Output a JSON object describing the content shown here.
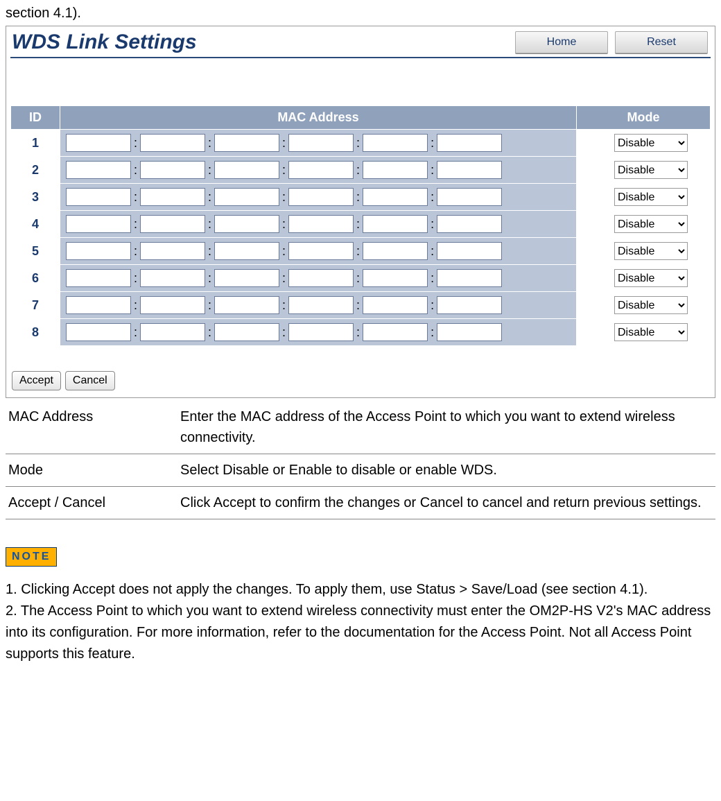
{
  "intro": "section 4.1).",
  "panel": {
    "title": "WDS Link Settings",
    "header_buttons": {
      "home": "Home",
      "reset": "Reset"
    },
    "table": {
      "headers": {
        "id": "ID",
        "mac": "MAC Address",
        "mode": "Mode"
      },
      "mac_sep": ":",
      "mode_options": [
        "Disable",
        "Enable"
      ],
      "rows": [
        {
          "id": "1",
          "mac": [
            "",
            "",
            "",
            "",
            "",
            ""
          ],
          "mode": "Disable"
        },
        {
          "id": "2",
          "mac": [
            "",
            "",
            "",
            "",
            "",
            ""
          ],
          "mode": "Disable"
        },
        {
          "id": "3",
          "mac": [
            "",
            "",
            "",
            "",
            "",
            ""
          ],
          "mode": "Disable"
        },
        {
          "id": "4",
          "mac": [
            "",
            "",
            "",
            "",
            "",
            ""
          ],
          "mode": "Disable"
        },
        {
          "id": "5",
          "mac": [
            "",
            "",
            "",
            "",
            "",
            ""
          ],
          "mode": "Disable"
        },
        {
          "id": "6",
          "mac": [
            "",
            "",
            "",
            "",
            "",
            ""
          ],
          "mode": "Disable"
        },
        {
          "id": "7",
          "mac": [
            "",
            "",
            "",
            "",
            "",
            ""
          ],
          "mode": "Disable"
        },
        {
          "id": "8",
          "mac": [
            "",
            "",
            "",
            "",
            "",
            ""
          ],
          "mode": "Disable"
        }
      ]
    },
    "footer_buttons": {
      "accept": "Accept",
      "cancel": "Cancel"
    }
  },
  "descriptions": [
    {
      "label": "MAC Address",
      "text": "Enter the MAC address of the Access Point to which you want to extend wireless connectivity."
    },
    {
      "label": "Mode",
      "text": "Select Disable or Enable to disable or enable WDS."
    },
    {
      "label": "Accept / Cancel",
      "text": "Click Accept to confirm the changes or Cancel to cancel and return previous settings."
    }
  ],
  "note_badge": "NOTE",
  "notes": [
    "1. Clicking Accept does not apply the changes. To apply them, use Status > Save/Load (see section 4.1).",
    "2. The Access Point to which you want to extend wireless connectivity must enter the OM2P-HS V2's MAC address into its configuration. For more information, refer to the documentation for the Access Point. Not all Access Point supports this feature."
  ]
}
